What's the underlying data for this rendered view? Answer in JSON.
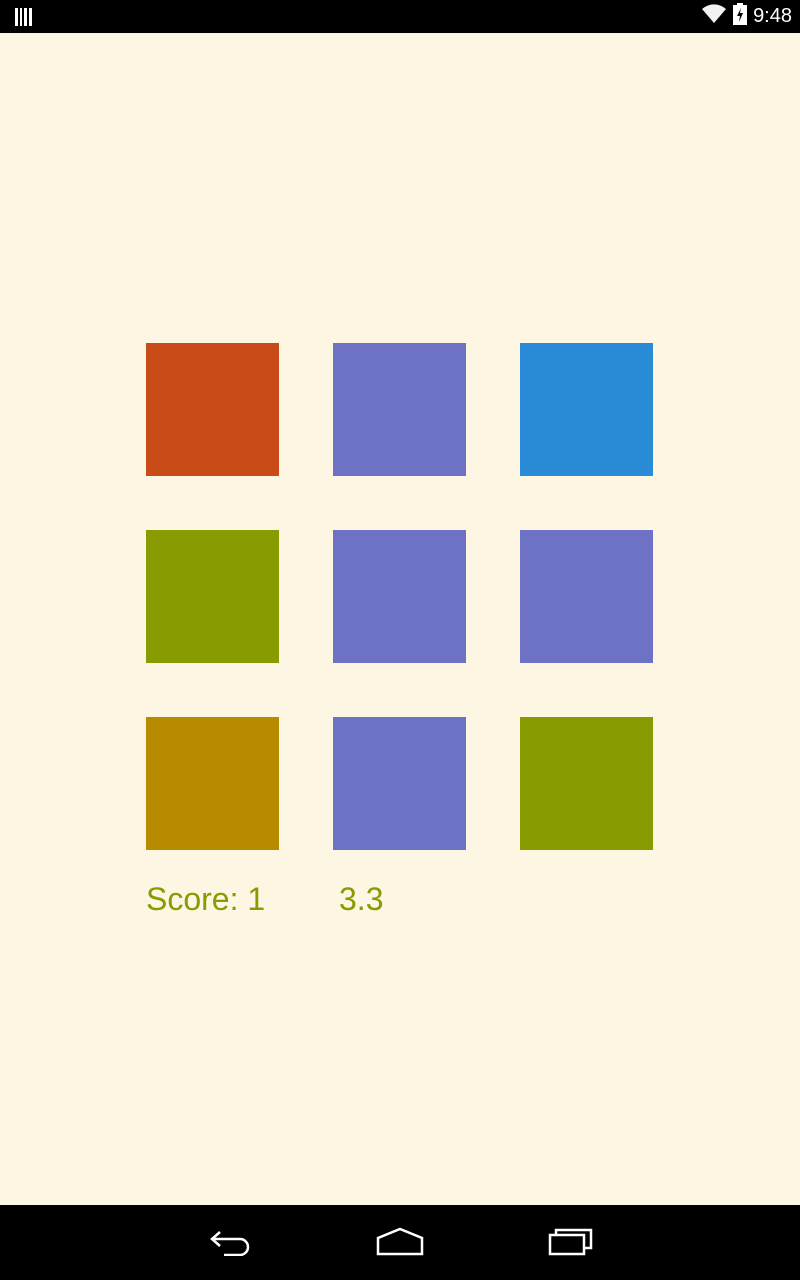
{
  "status_bar": {
    "time": "9:48",
    "left_icon": "barcode-icon",
    "right_icons": [
      "wifi-icon",
      "battery-charging-icon"
    ]
  },
  "game": {
    "background_color": "#fdf6e3",
    "grid": [
      [
        {
          "color": "#c94b17"
        },
        {
          "color": "#6d72c4"
        },
        {
          "color": "#2a8cd6"
        }
      ],
      [
        {
          "color": "#889b00"
        },
        {
          "color": "#6d72c4"
        },
        {
          "color": "#6d72c4"
        }
      ],
      [
        {
          "color": "#b88a00"
        },
        {
          "color": "#6d72c4"
        },
        {
          "color": "#889b00"
        }
      ]
    ],
    "score_text": "Score: 1",
    "timer_text": "3.3",
    "text_color": "#889b00"
  },
  "nav_bar": {
    "buttons": [
      "back-icon",
      "home-icon",
      "recent-apps-icon"
    ]
  }
}
